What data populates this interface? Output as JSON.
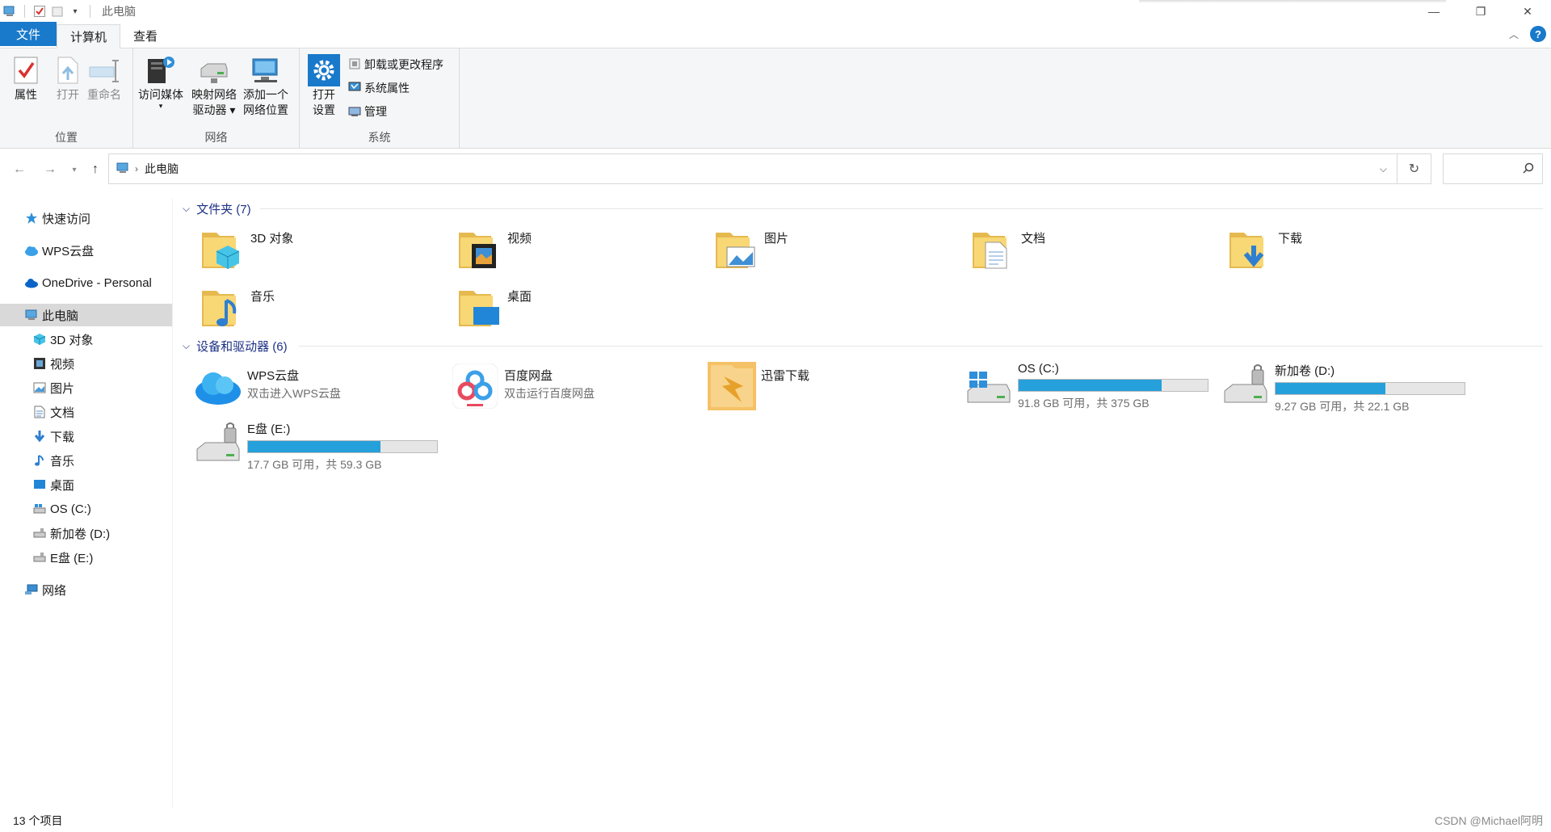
{
  "window": {
    "title": "此电脑",
    "controls": {
      "minimize": "—",
      "restore": "❐",
      "close": "✕"
    }
  },
  "ribbon_tabs": [
    {
      "label": "文件"
    },
    {
      "label": "计算机"
    },
    {
      "label": "查看"
    }
  ],
  "ribbon": {
    "groups": {
      "location": "位置",
      "network": "网络",
      "system": "系统"
    },
    "buttons": {
      "properties": "属性",
      "open": "打开",
      "rename": "重命名",
      "access_media": "访问媒体",
      "map_drive_l1": "映射网络",
      "map_drive_l2": "驱动器",
      "add_location_l1": "添加一个",
      "add_location_l2": "网络位置",
      "open_settings_l1": "打开",
      "open_settings_l2": "设置",
      "uninstall": "卸载或更改程序",
      "system_properties": "系统属性",
      "manage": "管理"
    }
  },
  "address": {
    "path": "此电脑",
    "search_placeholder": ""
  },
  "sidebar": {
    "items": [
      {
        "label": "快速访问",
        "icon": "star-icon"
      },
      {
        "label": "WPS云盘",
        "icon": "cloud-icon"
      },
      {
        "label": "OneDrive - Personal",
        "icon": "onedrive-icon"
      },
      {
        "label": "此电脑",
        "icon": "computer-icon",
        "selected": true
      },
      {
        "label": "3D 对象",
        "icon": "cube-icon"
      },
      {
        "label": "视频",
        "icon": "video-icon"
      },
      {
        "label": "图片",
        "icon": "picture-icon"
      },
      {
        "label": "文档",
        "icon": "document-icon"
      },
      {
        "label": "下载",
        "icon": "download-icon"
      },
      {
        "label": "音乐",
        "icon": "music-icon"
      },
      {
        "label": "桌面",
        "icon": "desktop-icon"
      },
      {
        "label": "OS (C:)",
        "icon": "drive-c-icon"
      },
      {
        "label": "新加卷 (D:)",
        "icon": "drive-icon"
      },
      {
        "label": "E盘 (E:)",
        "icon": "drive-icon"
      },
      {
        "label": "网络",
        "icon": "network-icon"
      }
    ]
  },
  "sections": {
    "folders": "文件夹 (7)",
    "devices": "设备和驱动器 (6)"
  },
  "folders": [
    {
      "name": "3D 对象",
      "icon": "folder-3d-icon"
    },
    {
      "name": "视频",
      "icon": "folder-video-icon"
    },
    {
      "name": "图片",
      "icon": "folder-pictures-icon"
    },
    {
      "name": "文档",
      "icon": "folder-documents-icon"
    },
    {
      "name": "下载",
      "icon": "folder-downloads-icon"
    },
    {
      "name": "音乐",
      "icon": "folder-music-icon"
    },
    {
      "name": "桌面",
      "icon": "folder-desktop-icon"
    }
  ],
  "devices": [
    {
      "name": "WPS云盘",
      "sub": "双击进入WPS云盘",
      "icon": "wps-cloud-icon"
    },
    {
      "name": "百度网盘",
      "sub": "双击运行百度网盘",
      "icon": "baidu-netdisk-icon"
    },
    {
      "name": "迅雷下载",
      "sub": "",
      "icon": "thunder-icon"
    },
    {
      "name": "OS (C:)",
      "sub": "91.8 GB 可用，共 375 GB",
      "icon": "drive-c-icon",
      "used_fraction": 0.755
    },
    {
      "name": "新加卷 (D:)",
      "sub": "9.27 GB 可用，共 22.1 GB",
      "icon": "drive-icon",
      "used_fraction": 0.58
    },
    {
      "name": "E盘 (E:)",
      "sub": "17.7 GB 可用，共 59.3 GB",
      "icon": "drive-icon",
      "used_fraction": 0.7
    }
  ],
  "status": {
    "count": "13 个项目",
    "watermark": "CSDN @Michael阿明"
  },
  "colors": {
    "accent": "#1979ca",
    "drive_fill": "#26a0da",
    "section_text": "#1e3287",
    "folder": "#f8d775"
  }
}
